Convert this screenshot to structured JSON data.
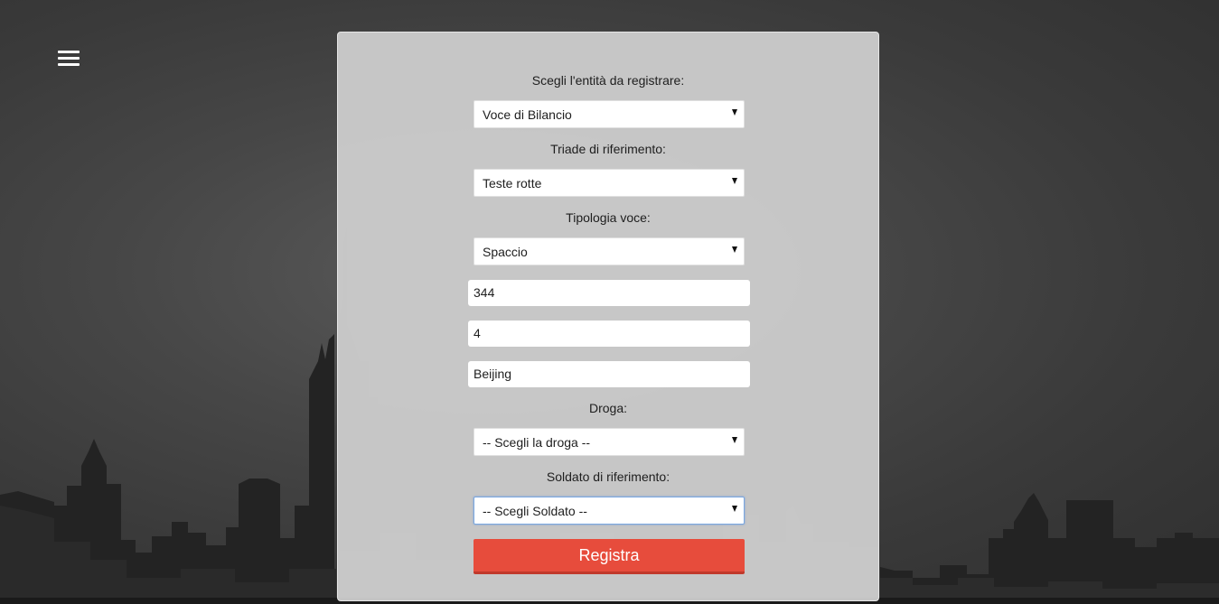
{
  "nav": {
    "menu_icon": "hamburger-menu-icon"
  },
  "form": {
    "entity_label": "Scegli l'entità da registrare:",
    "entity_value": "Voce di Bilancio",
    "triad_label": "Triade di riferimento:",
    "triad_value": "Teste rotte",
    "type_label": "Tipologia voce:",
    "type_value": "Spaccio",
    "amount_value": "344",
    "quantity_value": "4",
    "location_value": "Beijing",
    "drug_label": "Droga:",
    "drug_value": "-- Scegli la droga --",
    "soldier_label": "Soldato di riferimento:",
    "soldier_value": "-- Scegli Soldato --",
    "submit_label": "Registra"
  },
  "colors": {
    "accent": "#e74c3c",
    "accent_dark": "#c0392b",
    "panel": "#cdcdcd",
    "focus_border": "#7aa7e0"
  }
}
